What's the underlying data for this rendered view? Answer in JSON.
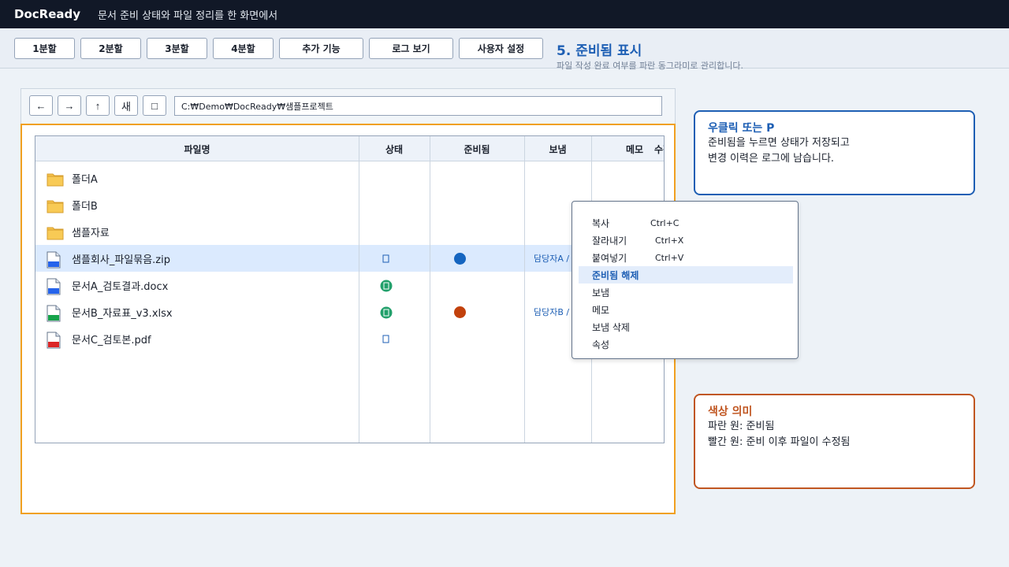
{
  "app": {
    "brand": "DocReady",
    "subtitle": "문서 준비 상태와 파일 정리를 한 화면에서"
  },
  "toolbar": {
    "buttons": [
      "1분할",
      "2분할",
      "3분할",
      "4분할",
      "추가 기능",
      "로그 보기",
      "사용자 설정"
    ]
  },
  "step": {
    "title": "5. 준비됨 표시",
    "description": "파일 작성 완료 여부를 파란 동그라미로 관리합니다."
  },
  "nav": {
    "back": "←",
    "forward": "→",
    "up": "↑",
    "new": "새",
    "extra": "□",
    "path": "C:₩Demo₩DocReady₩샘플프로젝트"
  },
  "table": {
    "headers": [
      "파일명",
      "상태",
      "준비됨",
      "보냄",
      "메모",
      "수정일"
    ],
    "rows": [
      {
        "name": "폴더A",
        "type": "folder",
        "selected": false,
        "status": "",
        "ready": "",
        "sent": ""
      },
      {
        "name": "폴더B",
        "type": "folder",
        "selected": false,
        "status": "",
        "ready": "",
        "sent": ""
      },
      {
        "name": "샘플자료",
        "type": "folder",
        "selected": false,
        "status": "",
        "ready": "",
        "sent": ""
      },
      {
        "name": "샘플회사_파일묶음.zip",
        "type": "zip",
        "selected": true,
        "status": "outline",
        "ready": "blue",
        "sent": "담당자A /"
      },
      {
        "name": "문서A_검토결과.docx",
        "type": "docx",
        "selected": false,
        "status": "green",
        "ready": "",
        "sent": ""
      },
      {
        "name": "문서B_자료표_v3.xlsx",
        "type": "xlsx",
        "selected": false,
        "status": "green",
        "ready": "red",
        "sent": "담당자B /"
      },
      {
        "name": "문서C_검토본.pdf",
        "type": "pdf",
        "selected": false,
        "status": "outline",
        "ready": "",
        "sent": ""
      }
    ]
  },
  "context_menu": {
    "items": [
      {
        "label": "복사",
        "shortcut": "Ctrl+C",
        "highlighted": false
      },
      {
        "label": "잘라내기",
        "shortcut": "Ctrl+X",
        "highlighted": false
      },
      {
        "label": "붙여넣기",
        "shortcut": "Ctrl+V",
        "highlighted": false
      },
      {
        "label": "준비됨 해제",
        "shortcut": "",
        "highlighted": true
      },
      {
        "label": "보냄",
        "shortcut": "",
        "highlighted": false
      },
      {
        "label": "메모",
        "shortcut": "",
        "highlighted": false
      },
      {
        "label": "보냄 삭제",
        "shortcut": "",
        "highlighted": false
      },
      {
        "label": "속성",
        "shortcut": "",
        "highlighted": false
      }
    ]
  },
  "cards": {
    "tip": {
      "title": "우클릭 또는 P",
      "lines": [
        "준비됨을 누르면 상태가 저장되고",
        "변경 이력은 로그에 남습니다."
      ]
    },
    "legend": {
      "title": "색상 의미",
      "lines": [
        "파란 원: 준비됨",
        "빨간 원: 준비 이후 파일이 수정됨"
      ]
    }
  },
  "colors": {
    "accent_blue": "#1e5fb4",
    "ready_blue": "#1565c0",
    "modified_red": "#c2410c",
    "status_green": "#22a06b",
    "highlight_border": "#f0a020",
    "legend_border": "#c05621"
  }
}
